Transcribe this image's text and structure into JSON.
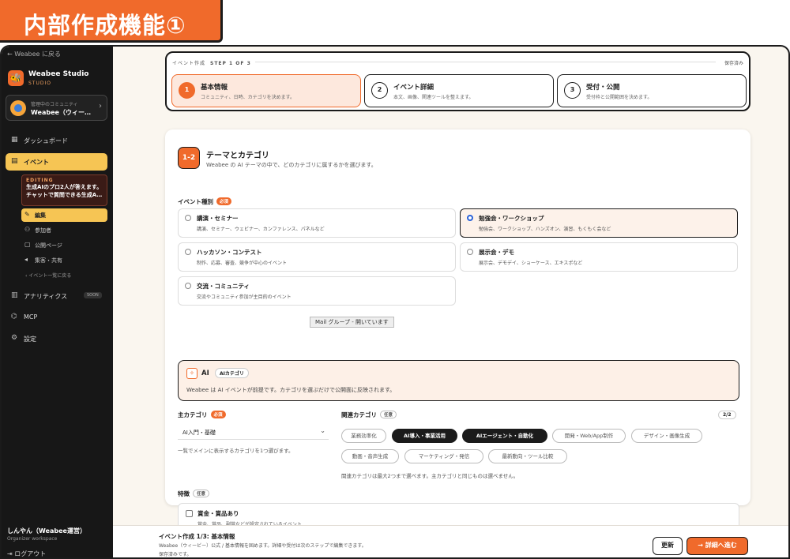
{
  "banner": {
    "title": "内部作成機能①"
  },
  "sidebar": {
    "back_link": "← Weabee に戻る",
    "brand_name": "Weabee Studio",
    "brand_sub": "STUDIO",
    "community_label": "管理中のコミュニティ",
    "community_name": "Weabee（ウィー…",
    "nav": [
      {
        "label": "ダッシュボード",
        "icon": "grid-icon"
      },
      {
        "label": "イベント",
        "icon": "calendar-icon",
        "active": true
      },
      {
        "label": "アナリティクス",
        "icon": "chart-icon",
        "badge": "SOON"
      },
      {
        "label": "MCP",
        "icon": "mcp-icon"
      },
      {
        "label": "設定",
        "icon": "settings-icon"
      }
    ],
    "editing_label": "EDITING",
    "editing_line1": "生成AIのプロ2人が答えます。",
    "editing_line2": "チャットで質問できる生成A…",
    "sub": [
      {
        "label": "編集",
        "icon": "pencil-icon",
        "active": true
      },
      {
        "label": "参加者",
        "icon": "people-icon"
      },
      {
        "label": "公開ページ",
        "icon": "page-icon"
      },
      {
        "label": "集客・共有",
        "icon": "megaphone-icon"
      }
    ],
    "back_to_list": "‹ イベント一覧に戻る",
    "user_name": "しんやん（Weabee運営）",
    "user_role": "Organizer workspace",
    "logout": "ログアウト"
  },
  "stepper": {
    "caption": "イベント作成",
    "step_of": "STEP 1 OF 3",
    "saved": "保存済み",
    "steps": [
      {
        "num": "1",
        "title": "基本情報",
        "desc": "コミュニティ、日時、カテゴリを決めます。"
      },
      {
        "num": "2",
        "title": "イベント詳細",
        "desc": "本文、画像、関連ツールを整えます。"
      },
      {
        "num": "3",
        "title": "受付・公開",
        "desc": "受付枠と公開範囲を決めます。"
      }
    ]
  },
  "section": {
    "badge": "1-2",
    "title": "テーマとカテゴリ",
    "desc": "Weabee の AI テーマの中で、どのカテゴリに属するかを選びます。"
  },
  "event_type": {
    "label": "イベント種別",
    "required": "必須",
    "options": [
      {
        "title": "講演・セミナー",
        "desc": "講演、セミナー、ウェビナー、カンファレンス、パネルなど"
      },
      {
        "title": "勉強会・ワークショップ",
        "desc": "勉強会、ワークショップ、ハンズオン、演習、もくもく会など",
        "selected": true
      },
      {
        "title": "ハッカソン・コンテスト",
        "desc": "制作、応募、審査、競争が中心のイベント"
      },
      {
        "title": "展示会・デモ",
        "desc": "展示会、デモデイ、ショーケース、エキスポなど"
      },
      {
        "title": "交流・コミュニティ",
        "desc": "交流やコミュニティ参加が主目的のイベント"
      }
    ],
    "tooltip": "Mail グループ - 開いています"
  },
  "ai_theme": {
    "title": "AI",
    "tag": "AIカテゴリ",
    "desc": "Weabee は AI イベントが前提です。カテゴリを選ぶだけで公開面に反映されます。"
  },
  "main_category": {
    "label": "主カテゴリ",
    "required": "必須",
    "value": "AI入門・基礎",
    "help": "一覧でメインに表示するカテゴリを1つ選びます。"
  },
  "related_category": {
    "label": "関連カテゴリ",
    "optional": "任意",
    "count": "2/2",
    "chips": [
      {
        "label": "業務効率化",
        "on": false
      },
      {
        "label": "AI導入・事業活用",
        "on": true
      },
      {
        "label": "AIエージェント・自動化",
        "on": true
      },
      {
        "label": "開発・Web/App制作",
        "on": false
      },
      {
        "label": "デザイン・画像生成",
        "on": false
      },
      {
        "label": "動画・音声生成",
        "on": false
      },
      {
        "label": "マーケティング・発信",
        "on": false
      },
      {
        "label": "最新動向・ツール比較",
        "on": false
      }
    ],
    "help": "関連カテゴリは最大2つまで選べます。主カテゴリと同じものは選べません。"
  },
  "features": {
    "label": "特徴",
    "optional": "任意",
    "title": "賞金・賞品あり",
    "desc": "賞金、賞品、副賞などが設定されているイベント"
  },
  "bottombar": {
    "title": "イベント作成 1/3: 基本情報",
    "desc": "Weabee（ウィービー）公式 / 基本情報を固めます。詳細や受付は次のステップで編集できます。",
    "status": "保存済みです。",
    "update_label": "更新",
    "next_label": "→ 詳細へ進む"
  },
  "colors": {
    "accent": "#f06a2b",
    "sidebar": "#171717",
    "highlight": "#f6c554"
  }
}
